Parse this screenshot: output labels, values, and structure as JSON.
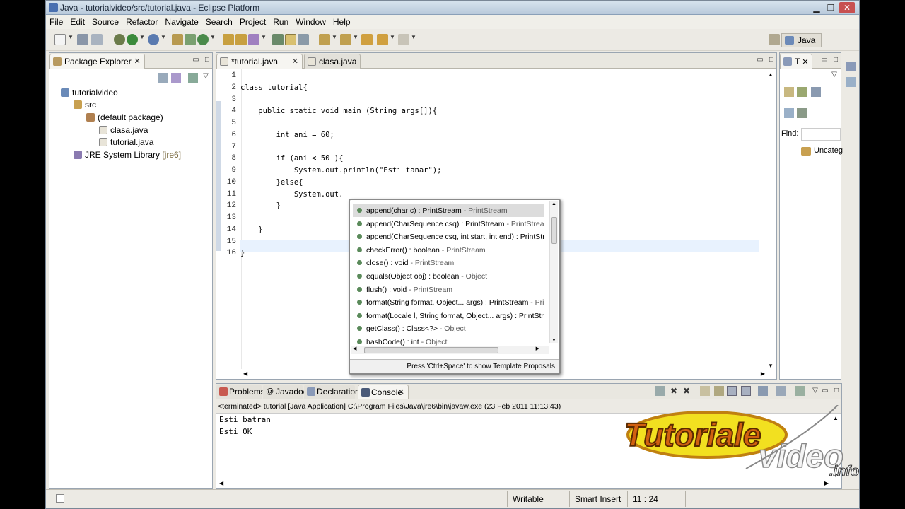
{
  "window": {
    "title": "Java - tutorialvideo/src/tutorial.java - Eclipse Platform"
  },
  "menu": [
    "File",
    "Edit",
    "Source",
    "Refactor",
    "Navigate",
    "Search",
    "Project",
    "Run",
    "Window",
    "Help"
  ],
  "perspective": {
    "label": "Java"
  },
  "package_explorer": {
    "title": "Package Explorer",
    "tree": [
      {
        "label": "tutorialvideo",
        "depth": 0
      },
      {
        "label": "src",
        "depth": 1
      },
      {
        "label": "(default package)",
        "depth": 2
      },
      {
        "label": "clasa.java",
        "depth": 3
      },
      {
        "label": "tutorial.java",
        "depth": 3
      },
      {
        "label": "JRE System Library",
        "suffix": "[jre6]",
        "depth": 1
      }
    ]
  },
  "editor": {
    "tabs": [
      {
        "label": "*tutorial.java"
      },
      {
        "label": "clasa.java"
      }
    ],
    "lines": [
      {
        "n": "1",
        "code": ""
      },
      {
        "n": "2",
        "code": "class tutorial{"
      },
      {
        "n": "3",
        "code": ""
      },
      {
        "n": "4",
        "code": "    public static void main (String args[]){"
      },
      {
        "n": "5",
        "code": ""
      },
      {
        "n": "6",
        "code": "        int ani = 60;"
      },
      {
        "n": "7",
        "code": ""
      },
      {
        "n": "8",
        "code": "        if (ani < 50 ){"
      },
      {
        "n": "9",
        "code": "            System.out.println(\"Esti tanar\");"
      },
      {
        "n": "10",
        "code": "        }else{"
      },
      {
        "n": "11",
        "code": "            System.out."
      },
      {
        "n": "12",
        "code": "        }"
      },
      {
        "n": "13",
        "code": ""
      },
      {
        "n": "14",
        "code": "    }"
      },
      {
        "n": "15",
        "code": ""
      },
      {
        "n": "16",
        "code": "}"
      }
    ]
  },
  "autocomplete": {
    "items": [
      {
        "sig": "append(char c) : PrintStream",
        "owner": " - PrintStream"
      },
      {
        "sig": "append(CharSequence csq) : PrintStream",
        "owner": " - PrintStream"
      },
      {
        "sig": "append(CharSequence csq, int start, int end) : PrintStream",
        "owner": ""
      },
      {
        "sig": "checkError() : boolean",
        "owner": " - PrintStream"
      },
      {
        "sig": "close() : void",
        "owner": " - PrintStream"
      },
      {
        "sig": "equals(Object obj) : boolean",
        "owner": " - Object"
      },
      {
        "sig": "flush() : void",
        "owner": " - PrintStream"
      },
      {
        "sig": "format(String format, Object... args) : PrintStream",
        "owner": " - PrintS"
      },
      {
        "sig": "format(Locale l, String format, Object... args) : PrintStrean",
        "owner": ""
      },
      {
        "sig": "getClass() : Class<?>",
        "owner": " - Object"
      },
      {
        "sig": "hashCode() : int",
        "owner": " - Object"
      }
    ],
    "footer": "Press 'Ctrl+Space' to show Template Proposals"
  },
  "outline": {
    "tab": "T",
    "find_label": "Find:",
    "category": "Uncateg"
  },
  "bottom": {
    "tabs": [
      "Problems",
      "Javadoc",
      "Declaration",
      "Console"
    ],
    "console_header": "<terminated> tutorial [Java Application] C:\\Program Files\\Java\\jre6\\bin\\javaw.exe (23 Feb 2011 11:13:43)",
    "output": [
      "Esti batran",
      "Esti OK"
    ]
  },
  "status": {
    "writable": "Writable",
    "insert": "Smart Insert",
    "position": "11 : 24"
  },
  "watermark": {
    "text": "Tutoriale",
    "text2": "video",
    "text3": ".info"
  },
  "colors": {
    "titlebar": "#c9d8e6",
    "chrome": "#eceae4",
    "selection": "#e8f2fe",
    "string": "#2a00ff",
    "field": "#0000c0"
  }
}
